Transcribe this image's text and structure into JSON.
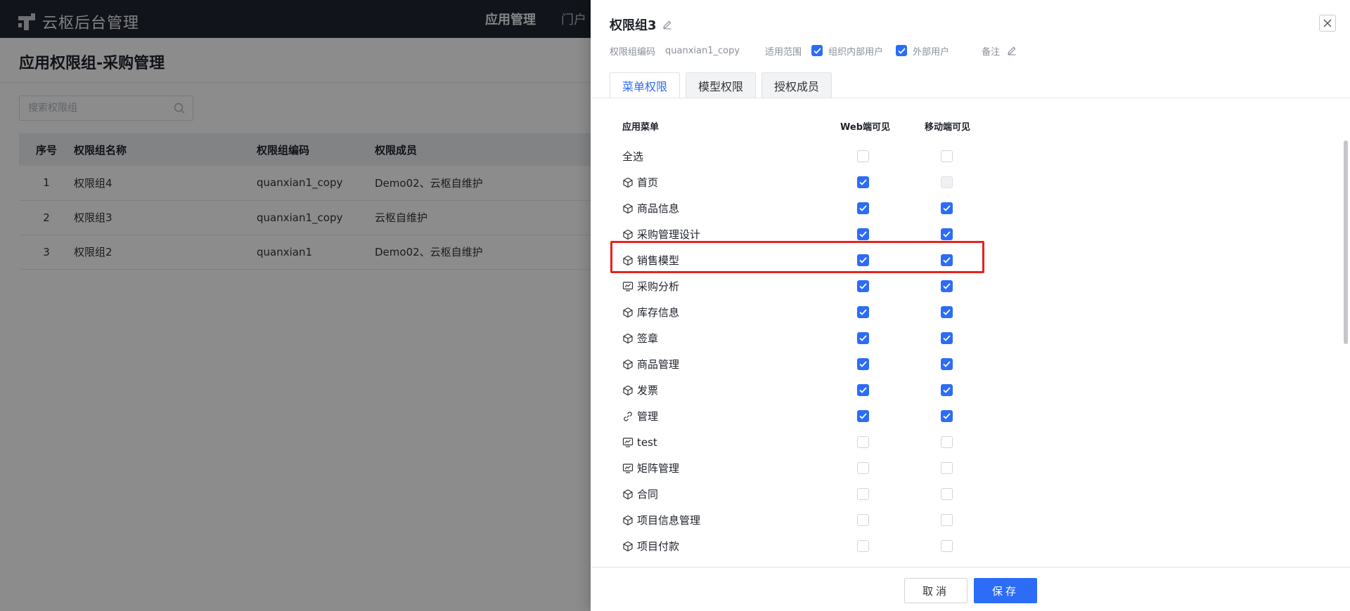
{
  "app": {
    "title": "云枢后台管理"
  },
  "topnav": {
    "items": [
      "应用管理",
      "门户"
    ]
  },
  "page": {
    "title": "应用权限组-采购管理"
  },
  "search": {
    "placeholder": "搜索权限组"
  },
  "table": {
    "headers": [
      "序号",
      "权限组名称",
      "权限组编码",
      "权限成员"
    ],
    "rows": [
      {
        "no": "1",
        "name": "权限组4",
        "code": "quanxian1_copy",
        "members": "Demo02、云枢自维护"
      },
      {
        "no": "2",
        "name": "权限组3",
        "code": "quanxian1_copy",
        "members": "云枢自维护"
      },
      {
        "no": "3",
        "name": "权限组2",
        "code": "quanxian1",
        "members": "Demo02、云枢自维护"
      }
    ]
  },
  "drawer": {
    "title": "权限组3",
    "code_label": "权限组编码",
    "code_value": "quanxian1_copy",
    "scope_label": "适用范围",
    "scope_internal": "组织内部用户",
    "scope_external": "外部用户",
    "remark_label": "备注",
    "tabs": [
      "菜单权限",
      "模型权限",
      "授权成员"
    ],
    "columns": {
      "menu": "应用菜单",
      "web": "Web端可见",
      "mobile": "移动端可见"
    },
    "select_all": {
      "label": "全选",
      "web": "off",
      "mobile": "off"
    },
    "menus": [
      {
        "label": "首页",
        "icon": "cube-icon",
        "web": "on",
        "mobile": "disabled"
      },
      {
        "label": "商品信息",
        "icon": "cube-icon",
        "web": "on",
        "mobile": "on"
      },
      {
        "label": "采购管理设计",
        "icon": "cube-icon",
        "web": "on",
        "mobile": "on"
      },
      {
        "label": "销售模型",
        "icon": "cube-icon",
        "web": "on",
        "mobile": "on"
      },
      {
        "label": "采购分析",
        "icon": "monitor-chart-icon",
        "web": "on",
        "mobile": "on"
      },
      {
        "label": "库存信息",
        "icon": "cube-icon",
        "web": "on",
        "mobile": "on"
      },
      {
        "label": "签章",
        "icon": "cube-icon",
        "web": "on",
        "mobile": "on"
      },
      {
        "label": "商品管理",
        "icon": "cube-icon",
        "web": "on",
        "mobile": "on"
      },
      {
        "label": "发票",
        "icon": "cube-icon",
        "web": "on",
        "mobile": "on"
      },
      {
        "label": "管理",
        "icon": "link-icon",
        "web": "on",
        "mobile": "on"
      },
      {
        "label": "test",
        "icon": "monitor-chart-icon",
        "web": "off",
        "mobile": "off"
      },
      {
        "label": "矩阵管理",
        "icon": "monitor-chart-icon",
        "web": "off",
        "mobile": "off"
      },
      {
        "label": "合同",
        "icon": "cube-icon",
        "web": "off",
        "mobile": "off"
      },
      {
        "label": "项目信息管理",
        "icon": "cube-icon",
        "web": "off",
        "mobile": "off"
      },
      {
        "label": "项目付款",
        "icon": "cube-icon",
        "web": "off",
        "mobile": "off"
      }
    ],
    "cancel_label": "取消",
    "save_label": "保存"
  },
  "colors": {
    "accent": "#2c6cf6",
    "highlight": "#e8221b",
    "topbar": "#1f2530"
  }
}
